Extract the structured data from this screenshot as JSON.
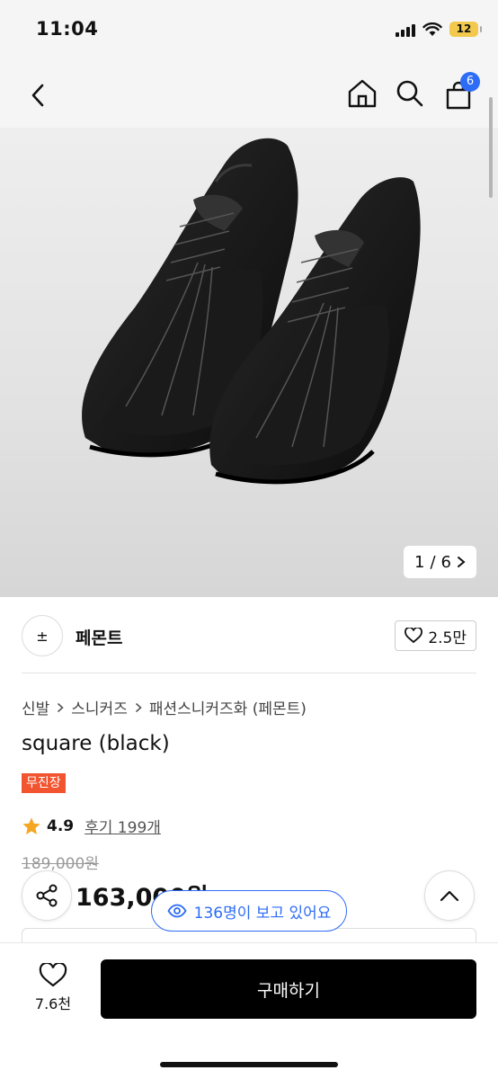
{
  "status": {
    "time": "11:04",
    "battery": "12"
  },
  "nav": {
    "cart_count": "6"
  },
  "gallery": {
    "current": "1",
    "separator": "/",
    "total": "6"
  },
  "seller": {
    "logo": "±",
    "name": "페몬트",
    "likes": "2.5만"
  },
  "breadcrumb": [
    "신발",
    "스니커즈",
    "패션스니커즈화 (페몬트)"
  ],
  "product": {
    "title": "square (black)",
    "tag": "무진장",
    "rating": "4.9",
    "reviews": "후기 199개",
    "original_price": "189,000원",
    "sale_price": "163,000원"
  },
  "viewers": "136명이 보고 있어요",
  "bottom": {
    "wish_count": "7.6천",
    "buy_label": "구매하기"
  },
  "colors": {
    "accent_blue": "#2d6cf6",
    "tag_red": "#f25430",
    "star": "#f5a623"
  }
}
